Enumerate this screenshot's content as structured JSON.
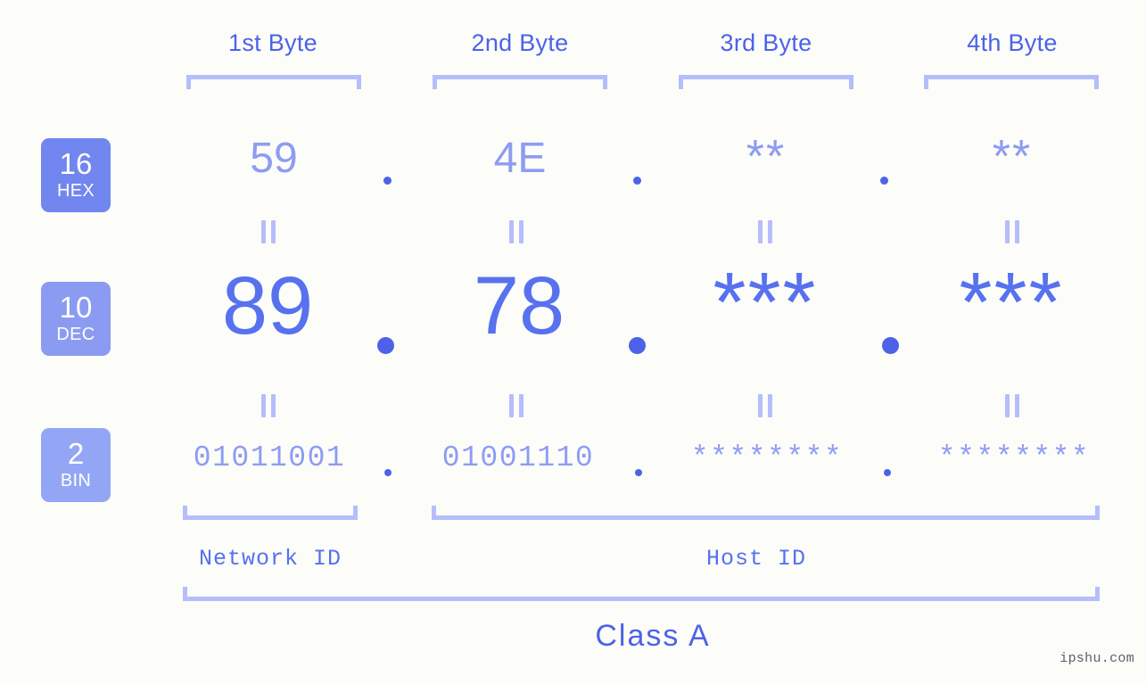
{
  "meta": {
    "background_color": "#fcfdf9",
    "accent_dark": "#4d62e8",
    "accent_mid": "#5771ef",
    "accent_light": "#8e9cf2",
    "bracket_color": "#b5bdfb",
    "watermark": "ipshu.com"
  },
  "byte_headers": [
    {
      "label": "1st Byte"
    },
    {
      "label": "2nd Byte"
    },
    {
      "label": "3rd Byte"
    },
    {
      "label": "4th Byte"
    }
  ],
  "radix_badges": [
    {
      "num": "16",
      "unit": "HEX",
      "color": "#7186ee"
    },
    {
      "num": "10",
      "unit": "DEC",
      "color": "#8b9bf2"
    },
    {
      "num": "2",
      "unit": "BIN",
      "color": "#93a6f5"
    }
  ],
  "rows": {
    "hex": {
      "values": [
        "59",
        "4E",
        "**",
        "**"
      ],
      "separator": "."
    },
    "dec": {
      "values": [
        "89",
        "78",
        "***",
        "***"
      ],
      "separator": "."
    },
    "bin": {
      "values": [
        "01011001",
        "01001110",
        "********",
        "********"
      ],
      "separator": "."
    }
  },
  "equals_marks": {
    "symbol": "||",
    "count_row1": 4,
    "count_row2": 4
  },
  "id_sections": [
    {
      "label": "Network ID"
    },
    {
      "label": "Host ID"
    }
  ],
  "class": {
    "label": "Class A"
  }
}
